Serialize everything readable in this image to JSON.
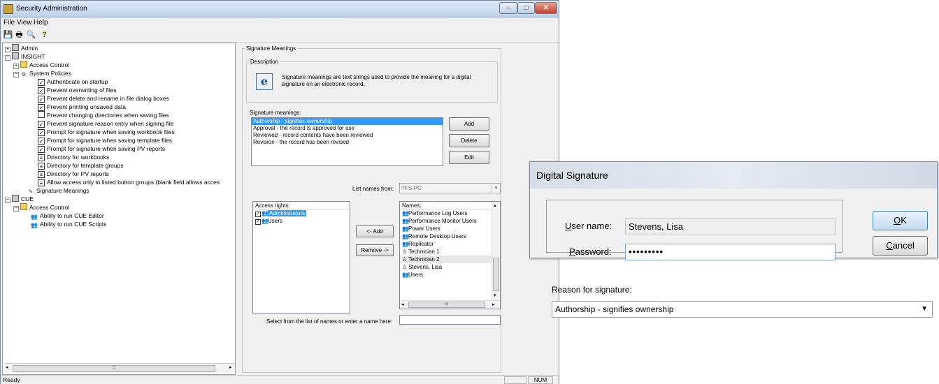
{
  "main_window": {
    "title": "Security Administration",
    "controls": {
      "minimize": "–",
      "maximize": "□",
      "close": "✕"
    }
  },
  "menu": {
    "file": "File",
    "view": "View",
    "help": "Help"
  },
  "toolbar": {
    "icons": [
      "save-icon",
      "print-icon",
      "print-preview-icon",
      "help-icon"
    ]
  },
  "tree": {
    "items": [
      {
        "label": "Admin",
        "icon": "server-icon"
      },
      {
        "label": "INSIGHT",
        "icon": "server-icon"
      },
      {
        "label": "Access Control",
        "icon": "folder-icon"
      },
      {
        "label": "System Policies",
        "icon": "policies-icon"
      },
      {
        "label": "Authenticate on startup",
        "icon": "checked-icon"
      },
      {
        "label": "Prevent overwriting of files",
        "icon": "checked-icon"
      },
      {
        "label": "Prevent delete and rename in file dialog boxes",
        "icon": "checked-icon"
      },
      {
        "label": "Prevent printing unsaved data",
        "icon": "checked-icon"
      },
      {
        "label": "Prevent changing directories when saving files",
        "icon": "unchecked-icon"
      },
      {
        "label": "Prevent signature reason entry when signing file",
        "icon": "checked-icon"
      },
      {
        "label": "Prompt for signature when saving workbook files",
        "icon": "checked-icon"
      },
      {
        "label": "Prompt for signature when saving template files",
        "icon": "checked-icon"
      },
      {
        "label": "Prompt for signature when saving PV reports",
        "icon": "checked-icon"
      },
      {
        "label": "Directory for workbooks",
        "icon": "list-icon"
      },
      {
        "label": "Directory for template groups",
        "icon": "list-icon"
      },
      {
        "label": "Directory for PV reports",
        "icon": "list-icon"
      },
      {
        "label": "Allow access only to listed button groups (blank field allows acces",
        "icon": "list-icon"
      },
      {
        "label": "Signature Meanings",
        "icon": "signature-icon"
      },
      {
        "label": "CUE",
        "icon": "server-icon"
      },
      {
        "label": "Access Control",
        "icon": "folder-icon"
      },
      {
        "label": "Ability to run CUE Editor",
        "icon": "users-icon"
      },
      {
        "label": "Ability to run CUE Scripts",
        "icon": "users-icon"
      }
    ]
  },
  "signature_panel": {
    "group_title": "Signature Meanings",
    "description_title": "Description",
    "description_text": "Signature meanings are text strings used to provide the meaning for a digital signature on an electronic record.",
    "meanings_label": "Signature meanings:",
    "meanings": [
      "Authorship - signifies ownership",
      "Approval - the record is approved for use",
      "Reviewed - record contents have been reviewed",
      "Revision - the record has been revised"
    ],
    "selected_meaning_index": 0,
    "add_label": "Add",
    "delete_label": "Delete",
    "edit_label": "Edit",
    "list_names_from_label": "List names from:",
    "list_names_from_value": "TFS-PC",
    "access_rights_header": "Access rights:",
    "access_rights": [
      {
        "label": "Administrators",
        "checked": true
      },
      {
        "label": "Users",
        "checked": true
      }
    ],
    "add_arrow_label": "<- Add",
    "remove_arrow_label": "Remove ->",
    "names_header": "Names:",
    "names": [
      "Performance Log Users",
      "Performance Monitor Users",
      "Power Users",
      "Remote Desktop Users",
      "Replicator",
      "Technician 1",
      "Technician 2",
      "Stevens, Lisa",
      "Users"
    ],
    "select_name_label": "Select from the list of names or enter a name here:",
    "select_name_value": ""
  },
  "statusbar": {
    "text": "Ready",
    "num": "NUM"
  },
  "dialog": {
    "title": "Digital Signature",
    "user_name_label_u": "U",
    "user_name_label_rest": "ser name:",
    "user_name_value": "Stevens, Lisa",
    "password_label_u": "P",
    "password_label_rest": "assword:",
    "password_value": "•••••••••",
    "ok_u": "O",
    "ok_rest": "K",
    "cancel_u": "C",
    "cancel_rest": "ancel",
    "reason_label": "Reason for signature:",
    "reason_value": "Authorship - signifies ownership"
  },
  "colors": {
    "selection": "#3399ff",
    "ok_border": "#3c7fb1"
  }
}
